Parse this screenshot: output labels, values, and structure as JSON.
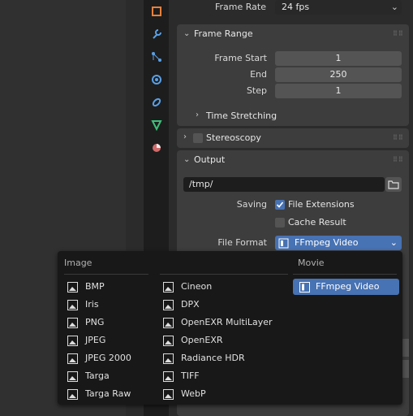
{
  "output_settings": {
    "frame_rate_label": "Frame Rate",
    "frame_rate_value": "24 fps",
    "frame_range": {
      "title": "Frame Range",
      "start_label": "Frame Start",
      "start_value": "1",
      "end_label": "End",
      "end_value": "250",
      "step_label": "Step",
      "step_value": "1",
      "time_stretching": "Time Stretching"
    },
    "stereoscopy": "Stereoscopy",
    "output": {
      "title": "Output",
      "path": "/tmp/",
      "saving_label": "Saving",
      "file_extensions": "File Extensions",
      "cache_result": "Cache Result",
      "file_format_label": "File Format",
      "file_format_value": "FFmpeg Video"
    }
  },
  "menu": {
    "columns": [
      {
        "header": "Image",
        "items": [
          "BMP",
          "Iris",
          "PNG",
          "JPEG",
          "JPEG 2000",
          "Targa",
          "Targa Raw"
        ]
      },
      {
        "header": "",
        "items": [
          "Cineon",
          "DPX",
          "OpenEXR MultiLayer",
          "OpenEXR",
          "Radiance HDR",
          "TIFF",
          "WebP"
        ]
      },
      {
        "header": "Movie",
        "items": [
          "FFmpeg Video"
        ]
      }
    ]
  },
  "colors": {
    "accent": "#4772b3",
    "panel": "#3d3d3d",
    "background": "#2b2b2b",
    "menu_bg": "#181818"
  }
}
